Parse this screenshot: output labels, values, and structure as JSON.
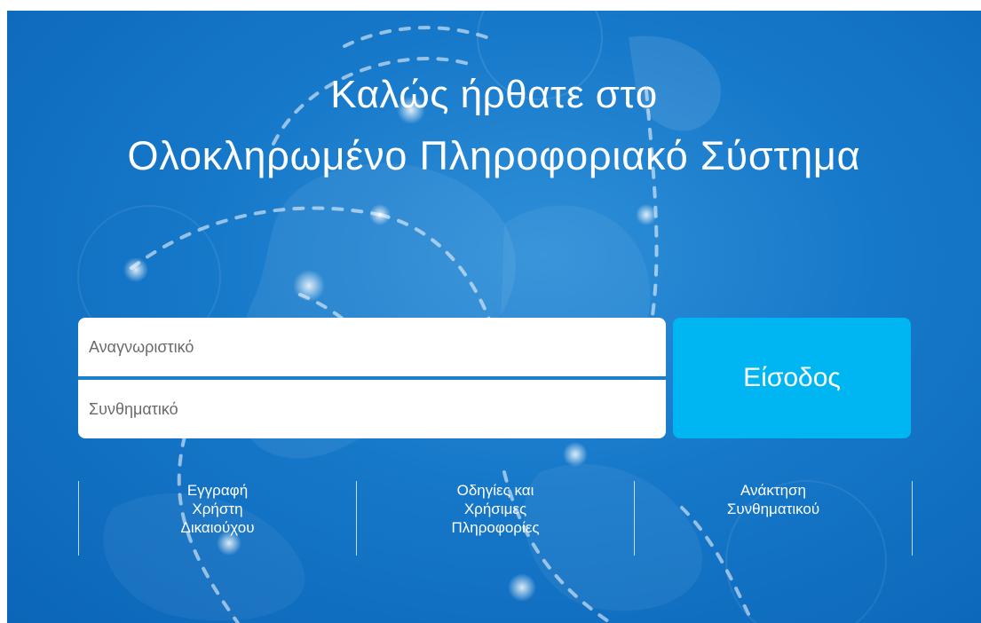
{
  "header": {
    "title_line1": "Καλώς ήρθατε στο",
    "title_line2": "Ολοκληρωμένο Πληροφοριακό Σύστημα"
  },
  "login": {
    "username_placeholder": "Αναγνωριστικό",
    "username_value": "",
    "password_placeholder": "Συνθηματικό",
    "password_value": "",
    "submit_label": "Είσοδος"
  },
  "links": [
    {
      "lines": [
        "Εγγραφή",
        "Χρήστη",
        "Δικαιούχου"
      ]
    },
    {
      "lines": [
        "Οδηγίες και",
        "Χρήσιμες",
        "Πληροφορίες"
      ]
    },
    {
      "lines": [
        "Ανάκτηση",
        "Συνθηματικού"
      ]
    }
  ],
  "colors": {
    "background": "#1678c9",
    "button": "#00b6f2",
    "text": "#ffffff"
  }
}
